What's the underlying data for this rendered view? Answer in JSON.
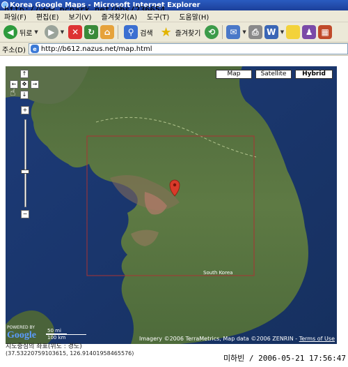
{
  "window": {
    "title": "Korea Google Maps - Microsoft Internet Explorer",
    "watermark": "http://www.pcpark.net/bbs/236654"
  },
  "menu": [
    "파일(F)",
    "편집(E)",
    "보기(V)",
    "즐겨찾기(A)",
    "도구(T)",
    "도움말(H)"
  ],
  "toolbar": {
    "back_label": "뒤로",
    "search_label": "검색",
    "favorites_label": "즐겨찾기"
  },
  "address": {
    "label": "주소(D)",
    "url": "http://b612.nazus.net/map.html"
  },
  "map": {
    "types": [
      "Map",
      "Satellite",
      "Hybrid"
    ],
    "selected_type": "Hybrid",
    "place_label": "South Korea",
    "scale_top": "50 mi",
    "scale_bottom": "100 km",
    "logo_powered": "POWERED BY",
    "logo_text": "Google",
    "credit": "Imagery ©2006 TerraMetrics, Map data ©2006 ZENRIN - ",
    "terms": "Terms of Use"
  },
  "coords": {
    "label": "지도중심의 좌표(위도 : 경도)",
    "value": "(37.53220759103615, 126.91401958465576)"
  },
  "stamp": "미하빈 / 2006-05-21 17:56:47"
}
